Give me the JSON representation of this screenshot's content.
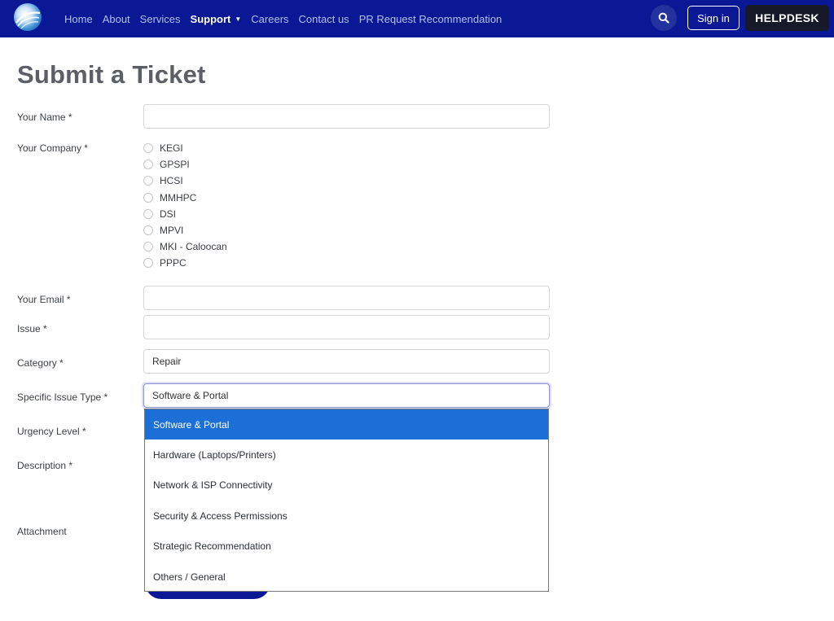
{
  "nav": {
    "links": [
      "Home",
      "About",
      "Services",
      "Support",
      "Careers",
      "Contact us",
      "PR Request Recommendation"
    ],
    "active": "Support",
    "signin_label": "Sign in",
    "helpdesk_label": "HELPDESK"
  },
  "page": {
    "title": "Submit a Ticket"
  },
  "form": {
    "name_label": "Your Name *",
    "name_value": "",
    "company_label": "Your Company *",
    "companies": [
      "KEGI",
      "GPSPI",
      "HCSI",
      "MMHPC",
      "DSI",
      "MPVI",
      "MKI - Caloocan",
      "PPPC"
    ],
    "email_label": "Your Email *",
    "email_value": "",
    "issue_label": "Issue *",
    "issue_value": "",
    "category_label": "Category *",
    "category_value": "Repair",
    "issue_type_label": "Specific Issue Type *",
    "issue_type_value": "Software & Portal",
    "urgency_label": "Urgency Level *",
    "description_label": "Description *",
    "attachment_label": "Attachment"
  },
  "dropdown": {
    "options": [
      "Software & Portal",
      "Hardware (Laptops/Printers)",
      "Network & ISP Connectivity",
      "Security & Access Permissions",
      "Strategic Recommendation",
      "Others / General"
    ],
    "selected": "Software & Portal"
  },
  "colors": {
    "navbar": "#0a1896",
    "helpdesk": "#151928",
    "selected_option": "#1b6fd6",
    "title": "#5c5f66"
  },
  "icons": {
    "logo": "logo-icon",
    "search": "search-icon",
    "caret": "caret-down-icon"
  }
}
